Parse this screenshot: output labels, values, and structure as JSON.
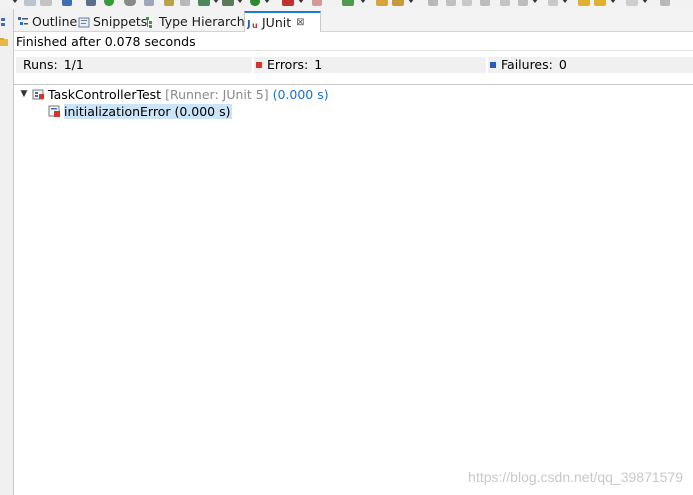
{
  "tabs": [
    {
      "label": "Outline",
      "icon": "outline-icon"
    },
    {
      "label": "Snippets",
      "icon": "snippets-icon"
    },
    {
      "label": "Type Hierarchy",
      "icon": "type-hierarchy-icon"
    },
    {
      "label": "JUnit",
      "icon": "junit-icon",
      "active": true,
      "close": "⊠"
    }
  ],
  "status": {
    "text": "Finished after 0.078 seconds"
  },
  "counters": {
    "runs_label": "Runs:",
    "runs_value": "1/1",
    "errors_label": "Errors:",
    "errors_value": "1",
    "failures_label": "Failures:",
    "failures_value": "0"
  },
  "tree": {
    "root": {
      "name": "TaskControllerTest",
      "runner": "[Runner: JUnit 5]",
      "time": "(0.000 s)",
      "expanded": true
    },
    "child": {
      "label": "initializationError (0.000 s)",
      "selected": true
    }
  },
  "watermark": "https://blog.csdn.net/qq_39871579",
  "colors": {
    "accent": "#1b7cd1",
    "error": "#d9342b",
    "failure": "#2a5bb8",
    "time_blue": "#1a73c8",
    "selection": "#cce4f7"
  }
}
